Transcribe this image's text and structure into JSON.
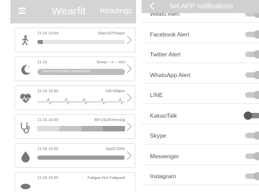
{
  "left_screen": {
    "header": {
      "title": "Wearfit",
      "readings_label": "Readings"
    },
    "cards": [
      {
        "time": "11-15 15:04",
        "metric": "Step:597/Steps",
        "icon": "walking-person-icon",
        "progress": 0.06
      },
      {
        "time": "11-15",
        "metric": "Sleep:-- h -- min",
        "icon": "moon-icon",
        "status": "Date temporarily unavailable"
      },
      {
        "time": "11-15 15:00",
        "metric": "HR:95bpm",
        "icon": "heart-rate-icon"
      },
      {
        "time": "11-15 15:00",
        "metric": "BP:152/87mmHg",
        "icon": "stethoscope-icon",
        "segments": 4
      },
      {
        "time": "11-15 15:00",
        "metric": "SpO2:99%",
        "icon": "blood-drop-icon",
        "progress": 0.99
      },
      {
        "time": "11-15 15:00",
        "metric": "Fatigue:Not Fatigued",
        "icon": "fatigue-icon"
      }
    ]
  },
  "right_screen": {
    "header": {
      "title": "Set APP notifications"
    },
    "rows": [
      {
        "label": "Weibo Alert",
        "state": "on"
      },
      {
        "label": "Facebook Alert",
        "state": "on"
      },
      {
        "label": "Twitter Alert",
        "state": "on"
      },
      {
        "label": "WhatsApp Alert",
        "state": "on"
      },
      {
        "label": "LINE",
        "state": "on"
      },
      {
        "label": "KakaoTalk",
        "state": "off"
      },
      {
        "label": "Skype",
        "state": "on"
      },
      {
        "label": "Messenger",
        "state": "on"
      },
      {
        "label": "Instagram",
        "state": "on"
      }
    ]
  }
}
